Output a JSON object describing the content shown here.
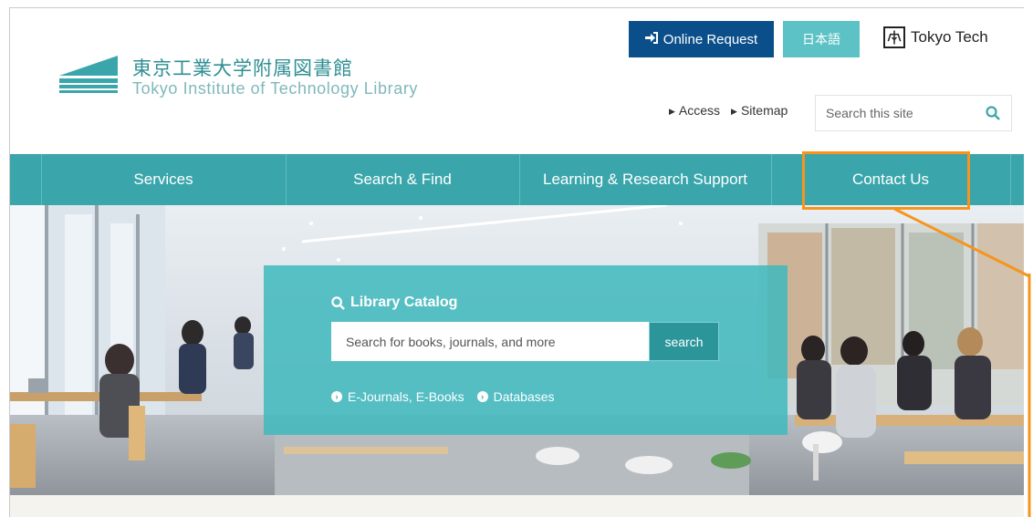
{
  "header": {
    "logo_jp": "東京工業大学附属図書館",
    "logo_en": "Tokyo Institute of Technology Library",
    "online_request": "Online Request",
    "language": "日本語",
    "tokyotech": "Tokyo Tech",
    "access": "Access",
    "sitemap": "Sitemap",
    "search_placeholder": "Search this site"
  },
  "nav": {
    "items": [
      {
        "label": "Services"
      },
      {
        "label": "Search & Find"
      },
      {
        "label": "Learning & Research Support"
      },
      {
        "label": "Contact Us"
      }
    ]
  },
  "catalog": {
    "title": "Library Catalog",
    "placeholder": "Search for books, journals, and more",
    "button": "search",
    "links": [
      "E-Journals, E-Books",
      "Databases"
    ]
  },
  "colors": {
    "teal": "#3aa6ab",
    "navy": "#0b4f8a",
    "annotation": "#f7941d"
  }
}
